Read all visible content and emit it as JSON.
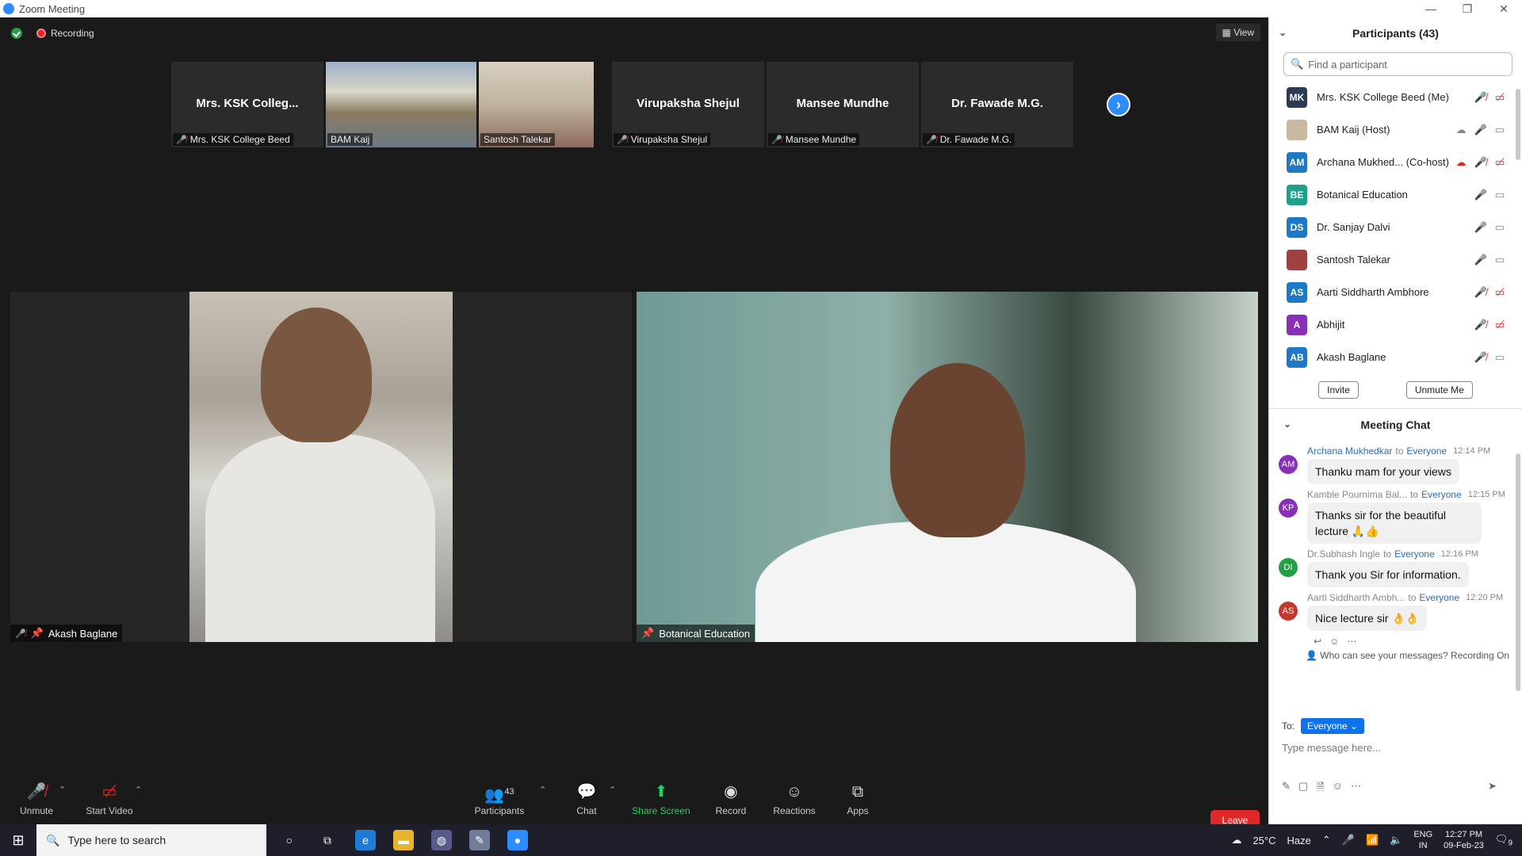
{
  "window": {
    "title": "Zoom Meeting",
    "min": "—",
    "max": "❐",
    "close": "✕"
  },
  "topbar": {
    "recording": "Recording",
    "view": "View"
  },
  "thumbnails": [
    {
      "name": "Mrs. KSK Colleg...",
      "label": "Mrs. KSK College Beed",
      "muted": true,
      "video": false
    },
    {
      "name": "",
      "label": "BAM Kaij",
      "muted": false,
      "video": true
    },
    {
      "name": "",
      "label": "Santosh Talekar",
      "muted": false,
      "video": true
    },
    {
      "name": "Virupaksha Shejul",
      "label": "Virupaksha Shejul",
      "muted": true,
      "video": false
    },
    {
      "name": "Mansee Mundhe",
      "label": "Mansee Mundhe",
      "muted": true,
      "video": false
    },
    {
      "name": "Dr. Fawade M.G.",
      "label": "Dr. Fawade M.G.",
      "muted": true,
      "video": false
    }
  ],
  "main_videos": {
    "left_label": "Akash Baglane",
    "right_label": "Botanical Education"
  },
  "toolbar": {
    "unmute": "Unmute",
    "start_video": "Start Video",
    "participants": "Participants",
    "participants_count": "43",
    "chat": "Chat",
    "share_screen": "Share Screen",
    "record": "Record",
    "reactions": "Reactions",
    "apps": "Apps",
    "leave": "Leave"
  },
  "participants_panel": {
    "title": "Participants (43)",
    "search_placeholder": "Find a participant",
    "items": [
      {
        "initials": "MK",
        "name": "Mrs. KSK College Beed (Me)",
        "color": "#2b3a55",
        "mic": "muted",
        "cam": "off"
      },
      {
        "initials": "",
        "name": "BAM Kaij (Host)",
        "color": "#c9b7a0",
        "mic": "on",
        "cam": "on"
      },
      {
        "initials": "AM",
        "name": "Archana Mukhed... (Co-host)",
        "color": "#1e78c8",
        "mic": "muted",
        "cam": "off"
      },
      {
        "initials": "BE",
        "name": "Botanical Education",
        "color": "#1fa08a",
        "mic": "on",
        "cam": "on"
      },
      {
        "initials": "DS",
        "name": "Dr. Sanjay Dalvi",
        "color": "#1e78c8",
        "mic": "on",
        "cam": "on"
      },
      {
        "initials": "",
        "name": "Santosh Talekar",
        "color": "#a04040",
        "mic": "on",
        "cam": "on"
      },
      {
        "initials": "AS",
        "name": "Aarti Siddharth Ambhore",
        "color": "#1e78c8",
        "mic": "muted",
        "cam": "off"
      },
      {
        "initials": "A",
        "name": "Abhijit",
        "color": "#8a2fb8",
        "mic": "muted",
        "cam": "off"
      },
      {
        "initials": "AB",
        "name": "Akash Baglane",
        "color": "#1e78c8",
        "mic": "muted",
        "cam": "on"
      }
    ],
    "invite": "Invite",
    "unmute_me": "Unmute Me"
  },
  "chat": {
    "title": "Meeting Chat",
    "messages": [
      {
        "initials": "AM",
        "color": "#8a2fb8",
        "from": "Archana Mukhedkar",
        "to": "Everyone",
        "time": "12:14 PM",
        "text": "Thanku mam for your views"
      },
      {
        "initials": "KP",
        "color": "#8a2fb8",
        "from": "Kamble Pournima Bal...",
        "to": "Everyone",
        "time": "12:15 PM",
        "text": "Thanks sir for the beautiful lecture 🙏👍"
      },
      {
        "initials": "DI",
        "color": "#23a043",
        "from": "Dr.Subhash Ingle",
        "to": "Everyone",
        "time": "12:16 PM",
        "text": "Thank you Sir for information."
      },
      {
        "initials": "AS",
        "color": "#c0392b",
        "from": "Aarti Siddharth Ambh...",
        "to": "Everyone",
        "time": "12:20 PM",
        "text": "Nice lecture sir 👌👌"
      }
    ],
    "to_word": "to",
    "privacy": "Who can see your messages? Recording On",
    "to_label": "To:",
    "recipient": "Everyone",
    "input_placeholder": "Type message here..."
  },
  "taskbar": {
    "search_placeholder": "Type here to search",
    "temp": "25°C",
    "weather": "Haze",
    "lang1": "ENG",
    "lang2": "IN",
    "time": "12:27 PM",
    "date": "09-Feb-23",
    "notifications": "9"
  }
}
